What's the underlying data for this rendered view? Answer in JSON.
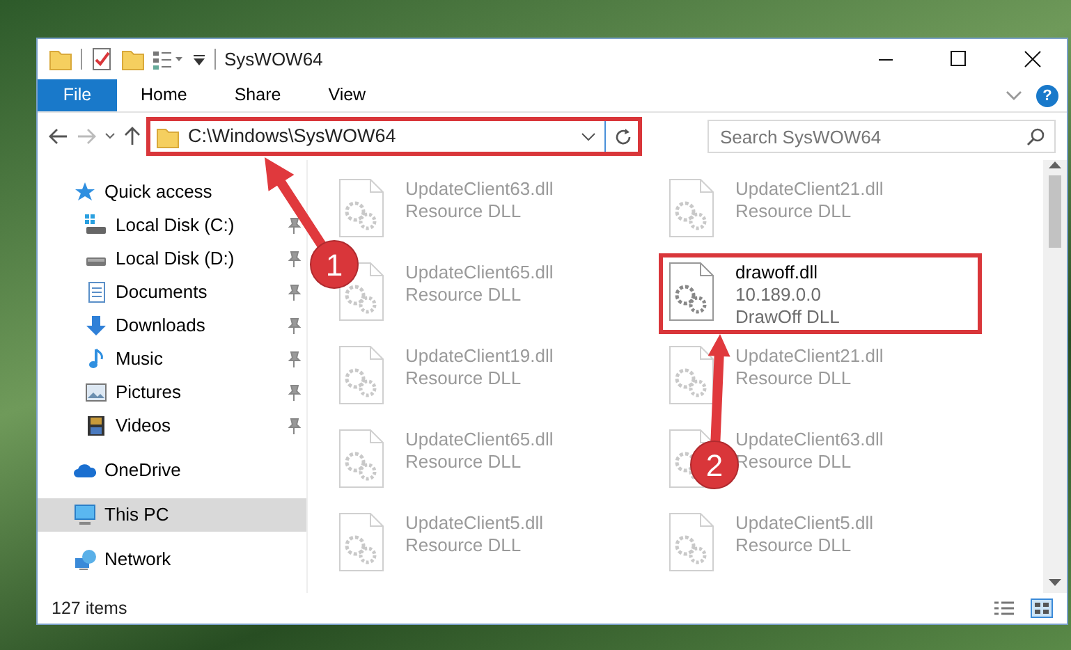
{
  "window": {
    "title": "SysWOW64"
  },
  "ribbon": {
    "file_tab": "File",
    "tabs": [
      "Home",
      "Share",
      "View"
    ],
    "help": "?"
  },
  "address": {
    "path": "C:\\Windows\\SysWOW64",
    "highlighted": true
  },
  "search": {
    "placeholder": "Search SysWOW64"
  },
  "nav": [
    {
      "label": "Quick access",
      "kind": "star",
      "selected": false,
      "children": [
        {
          "label": "Local Disk (C:)",
          "kind": "drive-win",
          "pinned": true
        },
        {
          "label": "Local Disk (D:)",
          "kind": "drive",
          "pinned": true
        },
        {
          "label": "Documents",
          "kind": "documents",
          "pinned": true
        },
        {
          "label": "Downloads",
          "kind": "downloads",
          "pinned": true
        },
        {
          "label": "Music",
          "kind": "music",
          "pinned": true
        },
        {
          "label": "Pictures",
          "kind": "pictures",
          "pinned": true
        },
        {
          "label": "Videos",
          "kind": "videos",
          "pinned": true
        }
      ]
    },
    {
      "label": "OneDrive",
      "kind": "cloud",
      "selected": false
    },
    {
      "label": "This PC",
      "kind": "pc",
      "selected": true
    },
    {
      "label": "Network",
      "kind": "network",
      "selected": false
    }
  ],
  "files": [
    {
      "name": "UpdateClient63.dll",
      "details": [
        "Resource DLL"
      ],
      "faded": true,
      "highlighted": false
    },
    {
      "name": "UpdateClient21.dll",
      "details": [
        "Resource DLL"
      ],
      "faded": true,
      "highlighted": false
    },
    {
      "name": "UpdateClient65.dll",
      "details": [
        "Resource DLL"
      ],
      "faded": true,
      "highlighted": false
    },
    {
      "name": "drawoff.dll",
      "details": [
        "10.189.0.0",
        "DrawOff DLL"
      ],
      "faded": false,
      "highlighted": true
    },
    {
      "name": "UpdateClient19.dll",
      "details": [
        "Resource DLL"
      ],
      "faded": true,
      "highlighted": false
    },
    {
      "name": "UpdateClient21.dll",
      "details": [
        "Resource DLL"
      ],
      "faded": true,
      "highlighted": false
    },
    {
      "name": "UpdateClient65.dll",
      "details": [
        "Resource DLL"
      ],
      "faded": true,
      "highlighted": false
    },
    {
      "name": "UpdateClient63.dll",
      "details": [
        "Resource DLL"
      ],
      "faded": true,
      "highlighted": false
    },
    {
      "name": "UpdateClient5.dll",
      "details": [
        "Resource DLL"
      ],
      "faded": true,
      "highlighted": false
    },
    {
      "name": "UpdateClient5.dll",
      "details": [
        "Resource DLL"
      ],
      "faded": true,
      "highlighted": false
    }
  ],
  "callouts": [
    "1",
    "2"
  ],
  "status_bar": {
    "count": "127 items"
  }
}
